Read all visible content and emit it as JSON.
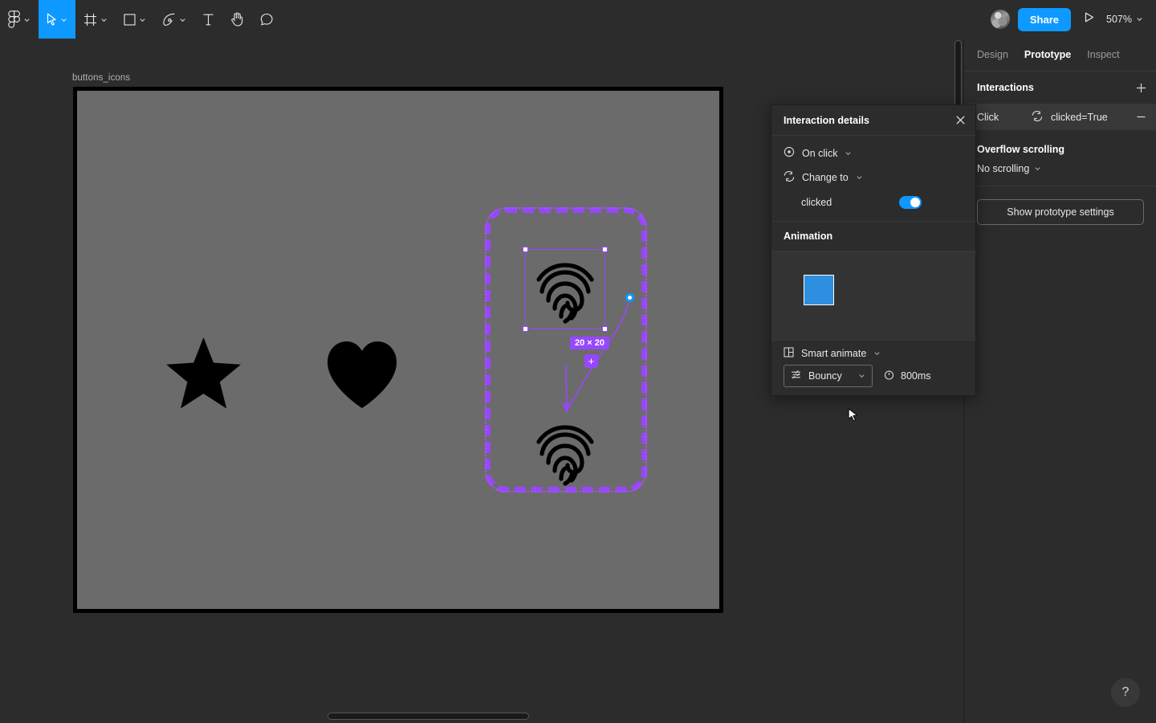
{
  "toolbar": {
    "tools": [
      {
        "name": "figma-logo-icon",
        "has_chevron": true
      },
      {
        "name": "move-cursor-icon",
        "has_chevron": true,
        "active": true
      },
      {
        "name": "frame-icon",
        "has_chevron": true
      },
      {
        "name": "rectangle-icon",
        "has_chevron": true
      },
      {
        "name": "pen-icon",
        "has_chevron": true
      },
      {
        "name": "text-icon",
        "has_chevron": false
      },
      {
        "name": "hand-icon",
        "has_chevron": false
      },
      {
        "name": "comment-icon",
        "has_chevron": false
      }
    ],
    "share_label": "Share",
    "present_icon": "play-icon",
    "zoom_level": "507%",
    "avatar": "user-avatar"
  },
  "canvas": {
    "frame_label": "buttons_icons",
    "frame_fill": "#6b6b6b",
    "frame_border": "#000000",
    "shapes": [
      {
        "name": "star-shape",
        "label": "star"
      },
      {
        "name": "heart-shape",
        "label": "heart"
      },
      {
        "name": "fingerprint-icon-source",
        "label": "fingerprint"
      },
      {
        "name": "fingerprint-icon-target",
        "label": "fingerprint"
      }
    ],
    "selection": {
      "size_label": "20 × 20",
      "accent": "#9747ff",
      "connector_dot_color": "#0d99ff",
      "add_node_label": "+"
    }
  },
  "right_panel": {
    "tabs": [
      {
        "label": "Design",
        "active": false
      },
      {
        "label": "Prototype",
        "active": true
      },
      {
        "label": "Inspect",
        "active": false
      }
    ],
    "interactions": {
      "title": "Interactions",
      "add_label": "+",
      "rows": [
        {
          "trigger": "Click",
          "action_icon": "change-to-icon",
          "destination": "clicked=True",
          "remove_label": "−"
        }
      ]
    },
    "overflow": {
      "title": "Overflow scrolling",
      "value": "No scrolling"
    },
    "prototype_settings_label": "Show prototype settings"
  },
  "popup": {
    "title": "Interaction details",
    "close_icon": "close-icon",
    "trigger": {
      "icon": "on-click-icon",
      "label": "On click"
    },
    "action": {
      "icon": "change-to-icon",
      "label": "Change to"
    },
    "variant": {
      "label": "clicked",
      "toggle_on": true,
      "toggle_color": "#0d99ff"
    },
    "animation": {
      "title": "Animation",
      "preview_color": "#2e8fe0",
      "type_icon": "smart-animate-icon",
      "type_label": "Smart animate",
      "easing_icon": "easing-icon",
      "easing_label": "Bouncy",
      "duration_icon": "clock-icon",
      "duration_label": "800ms"
    }
  },
  "help": {
    "label": "?"
  }
}
